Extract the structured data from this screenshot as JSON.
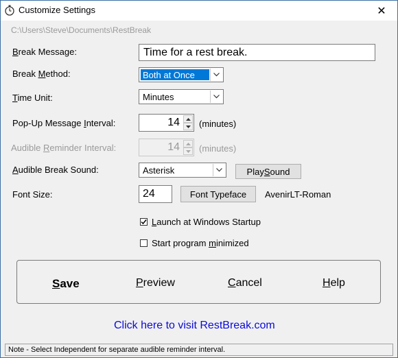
{
  "window": {
    "title": "Customize Settings",
    "close_glyph": "✕",
    "path": "C:\\Users\\Steve\\Documents\\RestBreak"
  },
  "form": {
    "break_message": {
      "label_pre": "",
      "label_key": "B",
      "label_post": "reak Message:",
      "value": "Time for a rest break."
    },
    "break_method": {
      "label_pre": "Break ",
      "label_key": "M",
      "label_post": "ethod:",
      "value": "Both at Once"
    },
    "time_unit": {
      "label_pre": "",
      "label_key": "T",
      "label_post": "ime Unit:",
      "value": "Minutes"
    },
    "popup_interval": {
      "label_pre": "Pop-Up Message ",
      "label_key": "I",
      "label_post": "nterval:",
      "value": "14",
      "unit": "(minutes)"
    },
    "audible_interval": {
      "label_pre": "Audible ",
      "label_key": "R",
      "label_post": "eminder Interval:",
      "value": "14",
      "unit": "(minutes)"
    },
    "break_sound": {
      "label_pre": "",
      "label_key": "A",
      "label_post": "udible Break Sound:",
      "value": "Asterisk",
      "play_pre": "Play ",
      "play_key": "S",
      "play_post": "ound"
    },
    "font_size": {
      "label": "Font Size:",
      "value": "24",
      "typeface_button": "Font Typeface",
      "typeface_name": "AvenirLT-Roman"
    },
    "launch_startup": {
      "label_pre": "",
      "label_key": "L",
      "label_post": "aunch at Windows Startup",
      "checked": true
    },
    "start_minimized": {
      "label_pre": "Start program ",
      "label_key": "m",
      "label_post": "inimized",
      "checked": false
    }
  },
  "actions": {
    "save_key": "S",
    "save_post": "ave",
    "preview_key": "P",
    "preview_post": "review",
    "cancel_key": "C",
    "cancel_post": "ancel",
    "help_key": "H",
    "help_post": "elp"
  },
  "link_text": "Click here to visit RestBreak.com",
  "status_text": "Note - Select Independent for separate audible reminder interval.",
  "icons": {
    "title": "stopwatch-icon",
    "dropdown": "chevron-down-icon",
    "spin_up": "spin-up-icon",
    "spin_down": "spin-down-icon",
    "check": "check-icon"
  },
  "colors": {
    "selection": "#0078d7",
    "link": "#0a0adc",
    "disabled_text": "#9a9a9a"
  }
}
